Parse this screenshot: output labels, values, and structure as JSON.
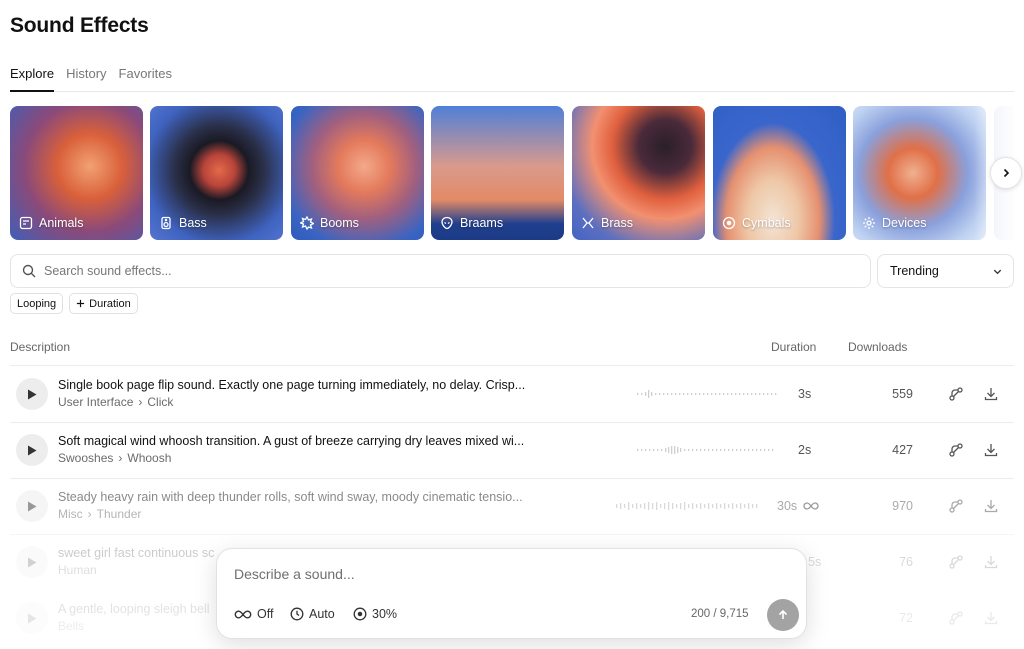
{
  "page": {
    "title": "Sound Effects"
  },
  "tabs": [
    {
      "label": "Explore",
      "active": true
    },
    {
      "label": "History",
      "active": false
    },
    {
      "label": "Favorites",
      "active": false
    }
  ],
  "categories": [
    {
      "label": "Animals",
      "icon": "animals-icon"
    },
    {
      "label": "Bass",
      "icon": "speaker-icon"
    },
    {
      "label": "Booms",
      "icon": "burst-icon"
    },
    {
      "label": "Braams",
      "icon": "alien-icon"
    },
    {
      "label": "Brass",
      "icon": "brass-icon"
    },
    {
      "label": "Cymbals",
      "icon": "cymbal-icon"
    },
    {
      "label": "Devices",
      "icon": "gear-icon"
    }
  ],
  "search": {
    "placeholder": "Search sound effects...",
    "value": ""
  },
  "sort": {
    "selected": "Trending"
  },
  "filters": {
    "looping": "Looping",
    "duration": "Duration"
  },
  "table": {
    "headers": {
      "description": "Description",
      "duration": "Duration",
      "downloads": "Downloads"
    },
    "rows": [
      {
        "description": "Single book page flip sound. Exactly one page turning immediately, no delay. Crisp...",
        "category": "User Interface",
        "subcategory": "Click",
        "duration": "3s",
        "looping": false,
        "downloads": "559"
      },
      {
        "description": "Soft magical wind whoosh transition. A gust of breeze carrying dry leaves mixed wi...",
        "category": "Swooshes",
        "subcategory": "Whoosh",
        "duration": "2s",
        "looping": false,
        "downloads": "427"
      },
      {
        "description": "Steady heavy rain with deep thunder rolls, soft wind sway, moody cinematic tensio...",
        "category": "Misc",
        "subcategory": "Thunder",
        "duration": "30s",
        "looping": true,
        "downloads": "970"
      },
      {
        "description": "sweet girl fast continuous sc",
        "category": "Human",
        "subcategory": "",
        "duration": "5s",
        "looping": false,
        "downloads": "76"
      },
      {
        "description": "A gentle, looping sleigh bell",
        "category": "Bells",
        "subcategory": "",
        "duration": "",
        "looping": false,
        "downloads": "72"
      }
    ]
  },
  "prompt": {
    "placeholder": "Describe a sound...",
    "loop": "Off",
    "duration": "Auto",
    "influence": "30%",
    "char_count": "200 / 9,715"
  },
  "colors": {
    "accent": "#111111",
    "muted": "#6b6b6b",
    "play_bg": "#ededed",
    "send_bg": "#a3a3a3"
  }
}
